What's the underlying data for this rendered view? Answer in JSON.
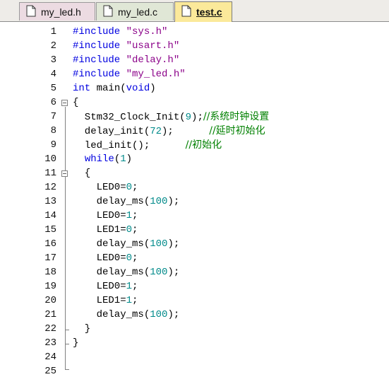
{
  "tabs": [
    {
      "label": "my_led.h",
      "active": false,
      "color": "#ecdbe2"
    },
    {
      "label": "my_led.c",
      "active": false,
      "color": "#e0e7d6"
    },
    {
      "label": "test.c",
      "active": true,
      "color": "#fbe99a"
    }
  ],
  "editor": {
    "lines": [
      {
        "num": "1",
        "tokens": [
          [
            "inc",
            "#include "
          ],
          [
            "str",
            "\"sys.h\""
          ]
        ]
      },
      {
        "num": "2",
        "tokens": [
          [
            "inc",
            "#include "
          ],
          [
            "str",
            "\"usart.h\""
          ]
        ]
      },
      {
        "num": "3",
        "tokens": [
          [
            "inc",
            "#include "
          ],
          [
            "str",
            "\"delay.h\""
          ]
        ]
      },
      {
        "num": "4",
        "tokens": [
          [
            "inc",
            "#include "
          ],
          [
            "str",
            "\"my_led.h\""
          ]
        ]
      },
      {
        "num": "5",
        "tokens": [
          [
            "kw",
            "int"
          ],
          [
            "txt",
            " main("
          ],
          [
            "kw",
            "void"
          ],
          [
            "txt",
            ")"
          ]
        ]
      },
      {
        "num": "6",
        "tokens": [
          [
            "txt",
            "{"
          ]
        ]
      },
      {
        "num": "7",
        "tokens": [
          [
            "txt",
            "  Stm32_Clock_Init("
          ],
          [
            "num",
            "9"
          ],
          [
            "txt",
            ");"
          ],
          [
            "cmt",
            "//系统时钟设置"
          ]
        ]
      },
      {
        "num": "8",
        "tokens": [
          [
            "txt",
            "  delay_init("
          ],
          [
            "num",
            "72"
          ],
          [
            "txt",
            ");      "
          ],
          [
            "cmt",
            "//延时初始化"
          ]
        ]
      },
      {
        "num": "9",
        "tokens": [
          [
            "txt",
            "  led_init();      "
          ],
          [
            "cmt",
            "//初始化"
          ]
        ]
      },
      {
        "num": "10",
        "tokens": [
          [
            "txt",
            "  "
          ],
          [
            "kw",
            "while"
          ],
          [
            "txt",
            "("
          ],
          [
            "num",
            "1"
          ],
          [
            "txt",
            ")"
          ]
        ]
      },
      {
        "num": "11",
        "tokens": [
          [
            "txt",
            "  {"
          ]
        ]
      },
      {
        "num": "12",
        "tokens": [
          [
            "txt",
            "    LED0="
          ],
          [
            "num",
            "0"
          ],
          [
            "txt",
            ";"
          ]
        ]
      },
      {
        "num": "13",
        "tokens": [
          [
            "txt",
            "    delay_ms("
          ],
          [
            "num",
            "100"
          ],
          [
            "txt",
            ");"
          ]
        ]
      },
      {
        "num": "14",
        "tokens": [
          [
            "txt",
            "    LED0="
          ],
          [
            "num",
            "1"
          ],
          [
            "txt",
            ";"
          ]
        ]
      },
      {
        "num": "15",
        "tokens": [
          [
            "txt",
            "    LED1="
          ],
          [
            "num",
            "0"
          ],
          [
            "txt",
            ";"
          ]
        ]
      },
      {
        "num": "16",
        "tokens": [
          [
            "txt",
            "    delay_ms("
          ],
          [
            "num",
            "100"
          ],
          [
            "txt",
            ");"
          ]
        ]
      },
      {
        "num": "17",
        "tokens": [
          [
            "txt",
            "    LED0="
          ],
          [
            "num",
            "0"
          ],
          [
            "txt",
            ";"
          ]
        ]
      },
      {
        "num": "18",
        "tokens": [
          [
            "txt",
            "    delay_ms("
          ],
          [
            "num",
            "100"
          ],
          [
            "txt",
            ");"
          ]
        ]
      },
      {
        "num": "19",
        "tokens": [
          [
            "txt",
            "    LED0="
          ],
          [
            "num",
            "1"
          ],
          [
            "txt",
            ";"
          ]
        ]
      },
      {
        "num": "20",
        "tokens": [
          [
            "txt",
            "    LED1="
          ],
          [
            "num",
            "1"
          ],
          [
            "txt",
            ";"
          ]
        ]
      },
      {
        "num": "21",
        "tokens": [
          [
            "txt",
            "    delay_ms("
          ],
          [
            "num",
            "100"
          ],
          [
            "txt",
            ");"
          ]
        ]
      },
      {
        "num": "22",
        "tokens": [
          [
            "txt",
            "  }"
          ]
        ]
      },
      {
        "num": "23",
        "tokens": [
          [
            "txt",
            "}"
          ]
        ]
      },
      {
        "num": "24",
        "tokens": []
      },
      {
        "num": "25",
        "tokens": []
      }
    ]
  },
  "colors": {
    "keyword": "#0000e0",
    "string": "#8b0089",
    "number": "#008a8a",
    "comment": "#008000"
  }
}
